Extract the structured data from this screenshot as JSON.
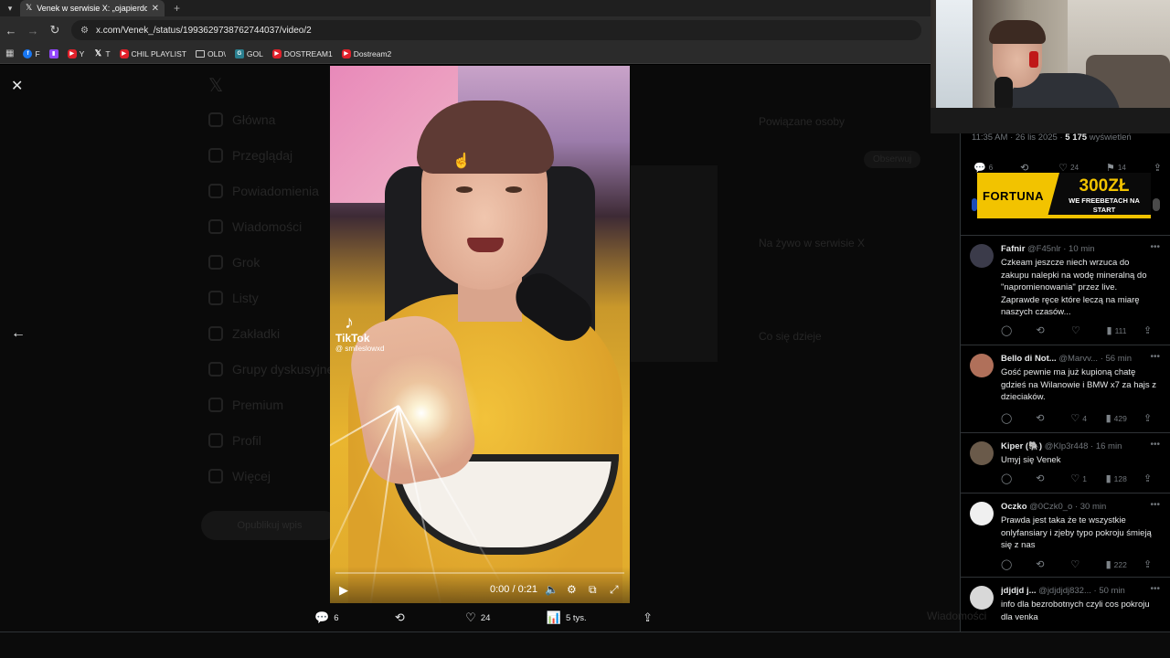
{
  "browser": {
    "tab_title": "Venek w serwisie X: „ojapierdol",
    "url": "x.com/Venek_/status/1993629738762744037/video/2",
    "bookmarks": [
      {
        "label": "F",
        "icon": "facebook-icon"
      },
      {
        "label": "",
        "icon": "twitch-icon"
      },
      {
        "label": "Y",
        "icon": "youtube-icon"
      },
      {
        "label": "T",
        "icon": "x-icon"
      },
      {
        "label": "CHIL PLAYLIST",
        "icon": "youtube-icon"
      },
      {
        "label": "OLD\\",
        "icon": "folder-icon"
      },
      {
        "label": "GOL",
        "icon": "gol-icon"
      },
      {
        "label": "DOSTREAM1",
        "icon": "youtube-icon"
      },
      {
        "label": "Dostream2",
        "icon": "youtube-icon"
      }
    ]
  },
  "background": {
    "nav_items": [
      "Główna",
      "Przeglądaj",
      "Powiadomienia",
      "Wiadomości",
      "Grok",
      "Listy",
      "Zakładki",
      "Grupy dyskusyjne",
      "Premium",
      "Profil",
      "Więcej"
    ],
    "post_button": "Opublikuj wpis",
    "right_headings": [
      "Powiązane osoby",
      "Na żywo w serwisie X",
      "Co się dzieje"
    ],
    "follow_button": "Obserwuj",
    "bottom_label": "Wiadomości"
  },
  "video": {
    "tiktok_name": "TikTok",
    "tiktok_handle": "@ smileslowxd",
    "time": "0:00 / 0:21",
    "progress": 0
  },
  "video_actions": {
    "replies": "6",
    "retweets": "",
    "likes": "24",
    "views": "5 tys."
  },
  "panel": {
    "time": "11:35 AM · 26 lis 2025 · ",
    "views_count": "5 175",
    "views_label": " wyświetleń",
    "stats": {
      "replies": "6",
      "retweets": "",
      "likes": "24",
      "bookmarks": "14"
    },
    "ad": {
      "brand": "FORTUNA",
      "amount": "300ZŁ",
      "tagline": "WE FREEBETACH NA START"
    },
    "replies": [
      {
        "name": "Fafnir",
        "meta": " @F45nlr · 10 min",
        "text": "Czkeam jeszcze niech wrzuca do zakupu nalepki na wodę mineralną do \"napromienowania\" przez live. Zaprawde ręce które leczą na miarę naszych czasów...",
        "replies": "",
        "retweets": "",
        "likes": "",
        "views": "111",
        "avatar_color": "#3b3b4a"
      },
      {
        "name": "Bello di Not...",
        "meta": " @Marvv... · 56 min",
        "text": "Gość pewnie ma już kupioną chatę gdzieś na Wilanowie i BMW x7 za hajs z dzieciaków.",
        "replies": "",
        "retweets": "",
        "likes": "4",
        "views": "429",
        "avatar_color": "#b0705a"
      },
      {
        "name": "Kiper (🐘)",
        "meta": " @Klp3r448 · 16 min",
        "text": "Umyj się Venek",
        "replies": "",
        "retweets": "",
        "likes": "1",
        "views": "128",
        "avatar_color": "#6a5a4a"
      },
      {
        "name": "Oczko",
        "meta": " @0Czk0_o · 30 min",
        "text": "Prawda jest taka że te wszystkie onlyfansiary i zjeby typo pokroju śmieją się z nas",
        "replies": "",
        "retweets": "",
        "likes": "",
        "views": "222",
        "avatar_color": "#f0f0f0"
      },
      {
        "name": "jdjdjd j...",
        "meta": " @jdjdjdj832... · 50 min",
        "text": "info dla bezrobotnych czyli cos pokroju dla venka",
        "replies": "",
        "retweets": "",
        "likes": "",
        "views": "",
        "avatar_color": "#d8d8d8"
      }
    ]
  },
  "colors": {
    "accent_yellow": "#f2c300",
    "text": "#e7e9ea",
    "muted": "#71767b"
  }
}
